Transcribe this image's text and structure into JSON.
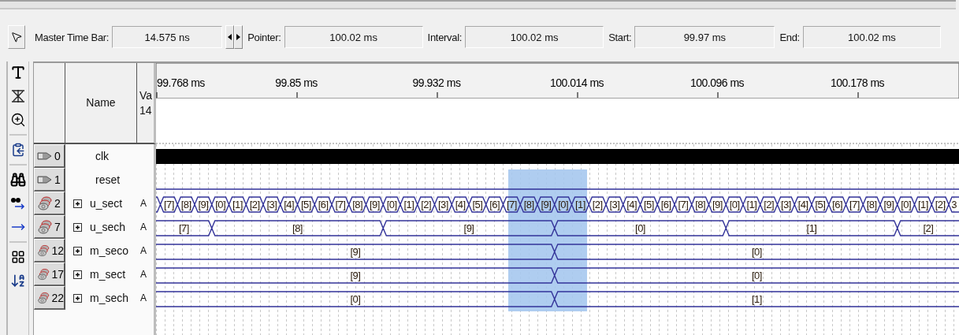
{
  "toolbar": {
    "fields": [
      {
        "label": "Master Time Bar:",
        "value": "14.575 ns",
        "kind": "time_bar"
      },
      {
        "label": "Pointer:",
        "value": "100.02 ms",
        "kind": "plain"
      },
      {
        "label": "Interval:",
        "value": "100.02 ms",
        "kind": "plain"
      },
      {
        "label": "Start:",
        "value": "99.97 ms",
        "kind": "plain"
      },
      {
        "label": "End:",
        "value": "100.02 ms",
        "kind": "plain"
      }
    ]
  },
  "grid": {
    "headers": {
      "name": "Name",
      "value": [
        "Va",
        "14"
      ]
    },
    "time_ticks": [
      "99.768 ms",
      "99.85 ms",
      "99.932 ms",
      "100.014 ms",
      "100.096 ms",
      "100.178 ms"
    ],
    "signals": [
      {
        "index": "0",
        "name": "clk",
        "kind": "clock"
      },
      {
        "index": "1",
        "name": "reset",
        "kind": "low"
      },
      {
        "index": "2",
        "name": "u_sect",
        "kind": "bus",
        "expanded": false,
        "value": "A",
        "segments": [
          "[7]",
          "[8]",
          "[9]",
          "[0]",
          "[1]",
          "[2]",
          "[3]",
          "[4]",
          "[5]",
          "[6]",
          "[7]",
          "[8]",
          "[9]",
          "[0]",
          "[1]",
          "[2]",
          "[3]",
          "[4]",
          "[5]",
          "[6]",
          "[7]",
          "[8]",
          "[9]",
          "[0]",
          "[1]",
          "[2]",
          "[3]",
          "[4]",
          "[5]",
          "[6]",
          "[7]",
          "[8]",
          "[9]",
          "[0]",
          "[1]",
          "[2]",
          "[3]",
          "[4]",
          "[5]",
          "[6]",
          "[7]",
          "[8]",
          "[9]",
          "[0]",
          "[1]",
          "[2]",
          "3"
        ]
      },
      {
        "index": "7",
        "name": "u_sech",
        "kind": "bus",
        "expanded": false,
        "value": "A",
        "segments": [
          "[7]",
          "[8]",
          "[9]",
          "[0]",
          "[1]",
          "[2]"
        ]
      },
      {
        "index": "12",
        "name": "m_seco",
        "kind": "bus",
        "expanded": false,
        "value": "A",
        "segments": [
          "[9]",
          "[0]"
        ]
      },
      {
        "index": "17",
        "name": "m_sect",
        "kind": "bus",
        "expanded": false,
        "value": "A",
        "segments": [
          "[9]",
          "[0]"
        ]
      },
      {
        "index": "22",
        "name": "m_sech",
        "kind": "bus",
        "expanded": false,
        "value": "A",
        "segments": [
          "[0]",
          "[1]"
        ]
      }
    ]
  }
}
